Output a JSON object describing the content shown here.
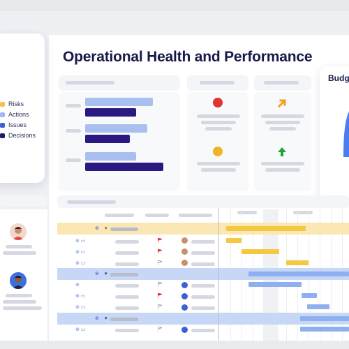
{
  "page": {
    "title": "Operational Health and Performance"
  },
  "legend": {
    "items": [
      {
        "label": "Risks",
        "color": "#f2c44e"
      },
      {
        "label": "Actions",
        "color": "#9db7f2"
      },
      {
        "label": "Issues",
        "color": "#3b5fd9"
      },
      {
        "label": "Decisions",
        "color": "#1a1e66"
      }
    ]
  },
  "budget": {
    "title": "Budge",
    "gauge_color": "#4a7df0"
  },
  "summary_bars": {
    "light_color": "#a9bff0",
    "dark_color": "#2a1980"
  },
  "status": {
    "health_colors": [
      "#e03333",
      "#f0b429"
    ],
    "trend_colors": [
      "#f0a020",
      "#22a33a"
    ],
    "trend_icons": [
      "arrow-up-right-icon",
      "arrow-up-icon"
    ]
  },
  "gantt": {
    "row_colors": {
      "yellow_group": "#fbe7b4",
      "blue_group": "#c7d7f6"
    },
    "bar_colors": {
      "yellow": "#f5c842",
      "blue": "#8fb0f0"
    }
  },
  "colors": {
    "brand_dark": "#161a4a",
    "flag_red": "#e03a3a"
  }
}
